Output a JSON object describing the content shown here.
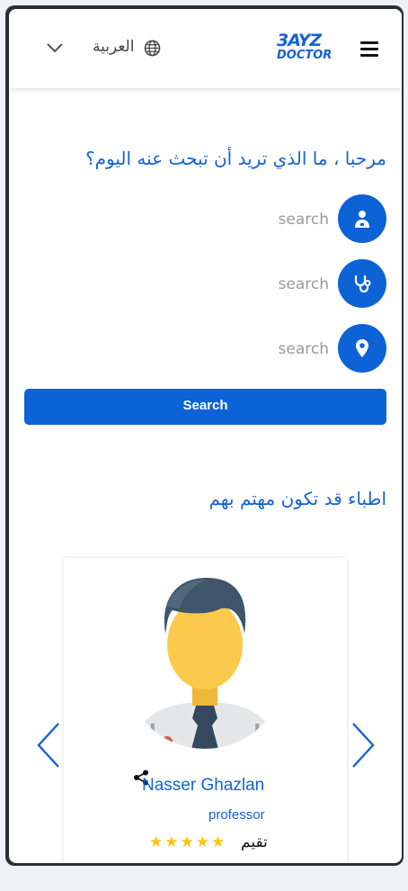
{
  "header": {
    "language": "العربية",
    "logo_line1": "3AYZ",
    "logo_line2": "DOCTOR"
  },
  "search": {
    "heading": "مرحبا ، ما الذي تريد أن تبحث عنه اليوم؟",
    "fields": [
      {
        "placeholder": "search",
        "icon": "doctor-icon"
      },
      {
        "placeholder": "search",
        "icon": "stethoscope-icon"
      },
      {
        "placeholder": "search",
        "icon": "location-icon"
      }
    ],
    "button_label": "Search"
  },
  "recommended": {
    "heading": "اطباء قد تكون مهتم بهم",
    "doctor": {
      "name": "Nasser Ghazlan",
      "title": "professor",
      "rating_label": "تقيم",
      "stars": "★★★★★",
      "rating": 5
    }
  },
  "colors": {
    "accent": "#0b63d5",
    "star": "#f5c518"
  }
}
